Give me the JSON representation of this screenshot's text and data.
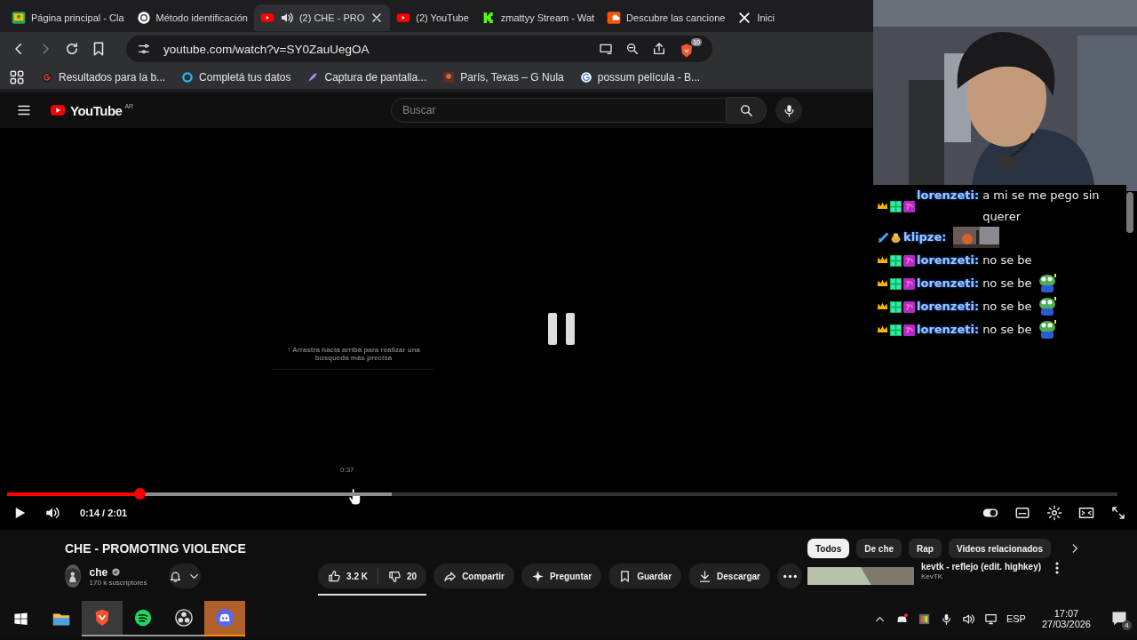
{
  "browser": {
    "tabs": [
      {
        "title": "Página principal - Cla",
        "selected": false,
        "audio": false
      },
      {
        "title": "Método identificación",
        "selected": false,
        "audio": false
      },
      {
        "title": "(2) CHE - PRO",
        "selected": true,
        "audio": true
      },
      {
        "title": "(2) YouTube",
        "selected": false,
        "audio": false
      },
      {
        "title": "zmattyy Stream - Wat",
        "selected": false,
        "audio": false
      },
      {
        "title": "Descubre las cancione",
        "selected": false,
        "audio": false
      },
      {
        "title": "Inici",
        "selected": false,
        "audio": false
      }
    ],
    "address": "youtube.com/watch?v=SY0ZauUegOA",
    "shields_count": "10",
    "bookmarks": [
      {
        "label": "Resultados para la b..."
      },
      {
        "label": "Completá tus datos"
      },
      {
        "label": "Captura de pantalla..."
      },
      {
        "label": "París, Texas – G Nula"
      },
      {
        "label": "possum película - B..."
      }
    ]
  },
  "youtube": {
    "logo": "YouTube",
    "country": "AR",
    "search_placeholder": "Buscar",
    "player": {
      "paused": true,
      "hint": "↑ Arrastra hacia arriba para realizar una búsqueda más precisa",
      "hover_time": "0:37",
      "progress": {
        "level": 0.12
      },
      "buffer": {
        "level": 0.346
      },
      "time": "0:14 / 2:01",
      "autoplay": true
    },
    "video": {
      "title": "CHE - PROMOTING VIOLENCE",
      "channel": "che",
      "subscribers": "170 k suscriptores",
      "likes": "3.2 K",
      "dislikes": "20",
      "actions": [
        {
          "label": "Compartir"
        },
        {
          "label": "Preguntar"
        },
        {
          "label": "Guardar"
        },
        {
          "label": "Descargar"
        }
      ]
    },
    "chips": [
      {
        "label": "Todos",
        "selected": true
      },
      {
        "label": "De che",
        "selected": false
      },
      {
        "label": "Rap",
        "selected": false
      },
      {
        "label": "Videos relacionados",
        "selected": false
      }
    ],
    "recommended": [
      {
        "title": "kevtk - reflejo (edit. highkey)",
        "channel": "KevTK"
      }
    ]
  },
  "stream_chat": [
    {
      "kind": "text",
      "user": "lorenzeti:",
      "text": "a mi se me pego sin querer",
      "emote": false
    },
    {
      "user": "klipze:"
    },
    {
      "kind": "text",
      "user": "lorenzeti:",
      "text": "no se be",
      "emote": false
    },
    {
      "kind": "text",
      "user": "lorenzeti:",
      "text": "no se be",
      "emote": true
    },
    {
      "kind": "text",
      "user": "lorenzeti:",
      "text": "no se be",
      "emote": true
    },
    {
      "kind": "text",
      "user": "lorenzeti:",
      "text": "no se be",
      "emote": true
    }
  ],
  "taskbar": {
    "apps": [
      {
        "active": false,
        "running": false,
        "flashing": false
      },
      {
        "active": true,
        "running": true,
        "flashing": false
      },
      {
        "active": false,
        "running": true,
        "flashing": false
      },
      {
        "active": false,
        "running": true,
        "flashing": false
      },
      {
        "active": false,
        "running": false,
        "flashing": true
      }
    ],
    "language": "ESP",
    "time": "17:07",
    "date": "27/03/2026",
    "notifications": "4"
  }
}
